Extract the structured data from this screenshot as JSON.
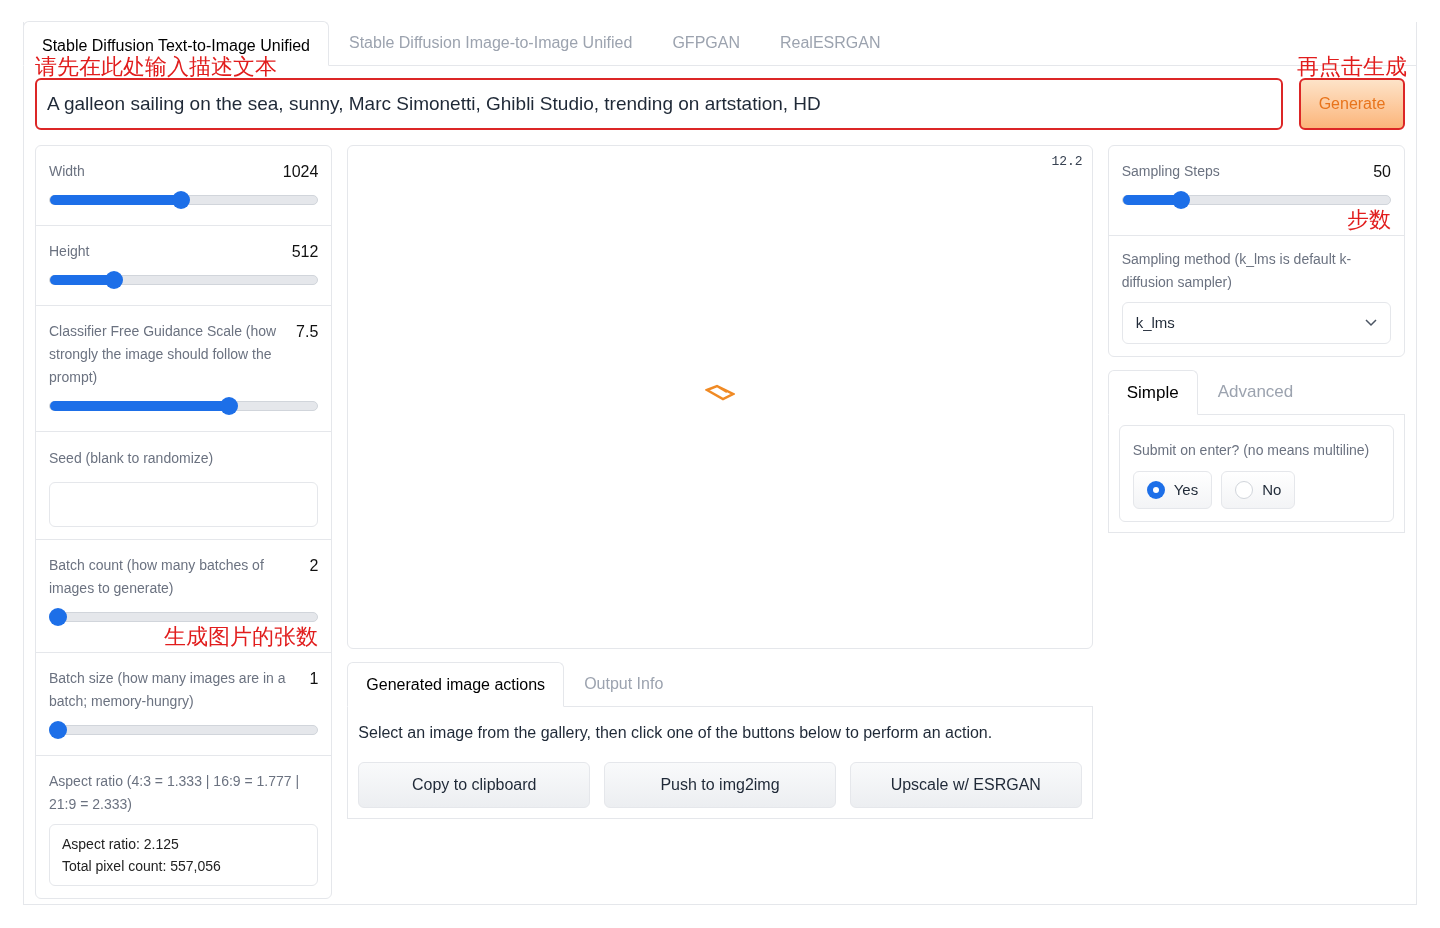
{
  "tabs": [
    {
      "label": "Stable Diffusion Text-to-Image Unified",
      "selected": true
    },
    {
      "label": "Stable Diffusion Image-to-Image Unified",
      "selected": false
    },
    {
      "label": "GFPGAN",
      "selected": false
    },
    {
      "label": "RealESRGAN",
      "selected": false
    }
  ],
  "prompt": {
    "value": "A galleon sailing on the sea, sunny, Marc Simonetti, Ghibli Studio, trending on artstation, HD",
    "annotation": "请先在此处输入描述文本"
  },
  "generate": {
    "label": "Generate",
    "annotation": "再点击生成"
  },
  "left_controls": [
    {
      "kind": "slider",
      "label": "Width",
      "reading": "1024",
      "level": 0.49
    },
    {
      "kind": "slider",
      "label": "Height",
      "reading": "512",
      "level": 0.24
    },
    {
      "kind": "slider",
      "label": "Classifier Free Guidance Scale (how strongly the image should follow the prompt)",
      "reading": "7.5",
      "level": 0.67
    },
    {
      "kind": "textbox",
      "label": "Seed (blank to randomize)"
    },
    {
      "kind": "slider",
      "label": "Batch count (how many batches of images to generate)",
      "reading": "2",
      "level": 0.03,
      "annotation": "生成图片的张数"
    },
    {
      "kind": "slider",
      "label": "Batch size (how many images are in a batch; memory-hungry)",
      "reading": "1",
      "level": 0.03
    },
    {
      "kind": "info",
      "label": "Aspect ratio (4:3 = 1.333 | 16:9 = 1.777 | 21:9 = 2.333)",
      "lines": [
        "Aspect ratio: 2.125",
        "Total pixel count: 557,056"
      ]
    }
  ],
  "gallery": {
    "timer": "12.2"
  },
  "action_tabs": [
    {
      "label": "Generated image actions",
      "selected": true
    },
    {
      "label": "Output Info",
      "selected": false
    }
  ],
  "action_text": "Select an image from the gallery, then click one of the buttons below to perform an action.",
  "action_buttons": [
    "Copy to clipboard",
    "Push to img2img",
    "Upscale w/ ESRGAN"
  ],
  "sampling_steps": {
    "label": "Sampling Steps",
    "reading": "50",
    "level": 0.22,
    "annotation": "步数"
  },
  "sampling_method": {
    "label": "Sampling method (k_lms is default k-diffusion sampler)",
    "value": "k_lms"
  },
  "mode_tabs": [
    {
      "label": "Simple",
      "selected": true
    },
    {
      "label": "Advanced",
      "selected": false
    }
  ],
  "submit_on_enter": {
    "label": "Submit on enter? (no means multiline)",
    "options": [
      {
        "label": "Yes",
        "selected": true
      },
      {
        "label": "No",
        "selected": false
      }
    ]
  }
}
